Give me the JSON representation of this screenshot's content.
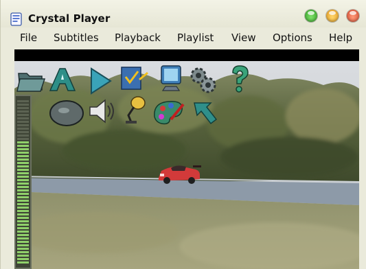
{
  "window": {
    "title": "Crystal Player"
  },
  "menu": {
    "items": [
      "File",
      "Subtitles",
      "Playback",
      "Playlist",
      "View",
      "Options",
      "Help"
    ]
  },
  "toolbar": {
    "row1": [
      "open-folder-icon",
      "font-icon",
      "play-icon",
      "checklist-icon",
      "monitor-icon",
      "gears-icon",
      "help-icon"
    ],
    "row2": [
      "disc-icon",
      "speaker-icon",
      "lamp-icon",
      "palette-icon",
      "back-arrow-icon"
    ]
  },
  "volume": {
    "level": 0.75
  },
  "colors": {
    "accent_teal": "#2f8f8a",
    "meter_green": "#8fd06a",
    "titlebar": "#eaeadb"
  }
}
